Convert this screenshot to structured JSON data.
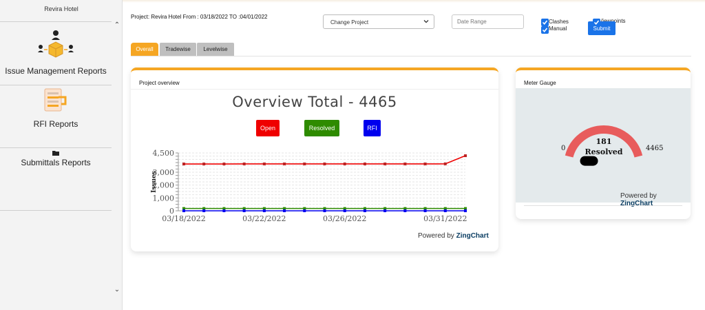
{
  "sidebar": {
    "title": "Revira Hotel",
    "items": [
      {
        "label": "Issue Management Reports",
        "icon": "issue-management-icon"
      },
      {
        "label": "RFI Reports",
        "icon": "rfi-document-icon"
      },
      {
        "label": "Submittals Reports",
        "icon": "folder-icon"
      }
    ]
  },
  "header": {
    "project_line": "Project: Revira Hotel From : 03/18/2022 TO :04/01/2022",
    "project_select": "Change Project",
    "date_range_placeholder": "Date Range",
    "checkboxes": [
      {
        "label": "Clashes",
        "checked": true
      },
      {
        "label": "Manual",
        "checked": true
      },
      {
        "label": "Viewpoints",
        "checked": true
      }
    ],
    "submit_label": "Submit"
  },
  "tabs": [
    {
      "label": "Overall",
      "active": true
    },
    {
      "label": "Tradewise",
      "active": false
    },
    {
      "label": "Levelwise",
      "active": false
    }
  ],
  "overview_card": {
    "title": "Project overview",
    "heading": "Overview Total - 4465",
    "powered_prefix": "Powered by",
    "powered_brand": "ZingChart"
  },
  "gauge_card": {
    "title": "Meter Gauge",
    "min_label": "0",
    "max_label": "4465",
    "value": 181,
    "max": 4465,
    "value_text": "181",
    "value_caption": "Resolved",
    "powered_prefix": "Powered by",
    "powered_brand": "ZingChart"
  },
  "colors": {
    "accent": "#f5a623",
    "open": "#ef0000",
    "resolved": "#2e8b00",
    "rfi": "#0000ee",
    "submit": "#1a73e8",
    "gauge_arc": "#e85c5c"
  },
  "chart_data": {
    "type": "line",
    "title": "Overview Total - 4465",
    "ylabel": "Issues",
    "xlabel": "",
    "ylim": [
      0,
      4500
    ],
    "yticks": [
      0,
      1000,
      2000,
      3000,
      4500
    ],
    "ytick_labels": [
      "0",
      "1,000",
      "2,000",
      "3,000",
      "4,500"
    ],
    "x": [
      "03/18/2022",
      "03/19/2022",
      "03/20/2022",
      "03/21/2022",
      "03/22/2022",
      "03/23/2022",
      "03/24/2022",
      "03/25/2022",
      "03/26/2022",
      "03/27/2022",
      "03/28/2022",
      "03/29/2022",
      "03/30/2022",
      "03/31/2022",
      "04/01/2022"
    ],
    "xtick_labels": [
      "03/18/2022",
      "03/22/2022",
      "03/26/2022",
      "03/31/2022"
    ],
    "series": [
      {
        "name": "Open",
        "color": "#ef0000",
        "values": [
          3640,
          3640,
          3640,
          3645,
          3645,
          3645,
          3645,
          3645,
          3645,
          3645,
          3645,
          3645,
          3645,
          3650,
          4284
        ]
      },
      {
        "name": "Resolved",
        "color": "#2e8b00",
        "values": [
          181,
          181,
          181,
          181,
          181,
          181,
          181,
          181,
          181,
          181,
          181,
          181,
          181,
          181,
          181
        ]
      },
      {
        "name": "RFI",
        "color": "#0000ee",
        "values": [
          0,
          0,
          0,
          0,
          0,
          0,
          0,
          0,
          0,
          0,
          0,
          0,
          0,
          0,
          0
        ]
      }
    ],
    "legend": "top-center",
    "grid": true
  }
}
